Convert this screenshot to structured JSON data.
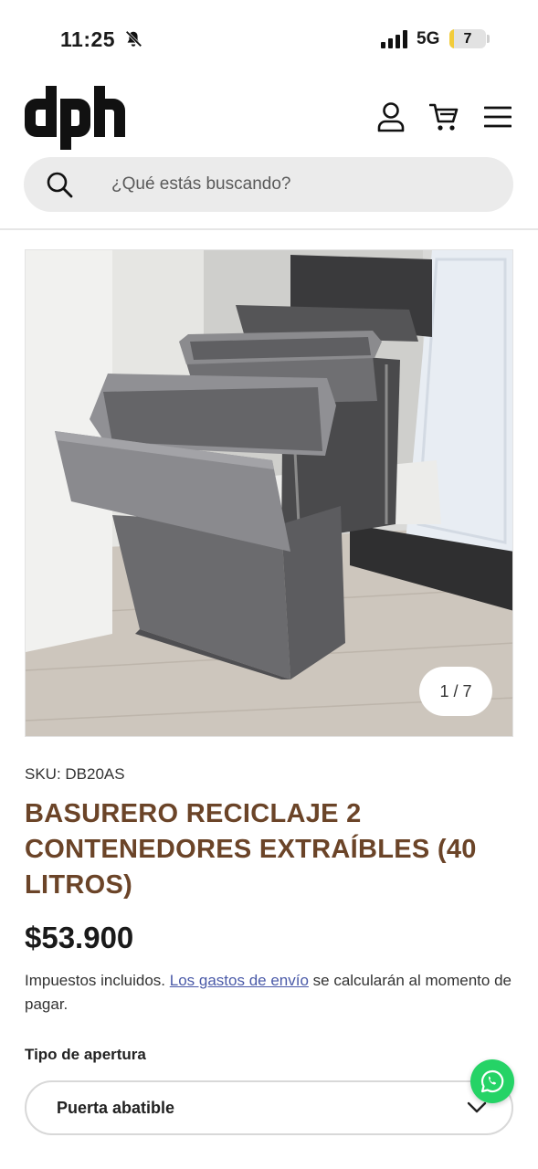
{
  "status_bar": {
    "time": "11:25",
    "network": "5G",
    "battery_level": "7",
    "battery_fraction": 0.07,
    "icons": [
      "bell-slash-icon",
      "signal-icon"
    ]
  },
  "header": {
    "logo_text": "dph",
    "icons": [
      "account-icon",
      "cart-icon",
      "menu-icon"
    ]
  },
  "search": {
    "placeholder": "¿Qué estás buscando?",
    "value": ""
  },
  "gallery": {
    "counter": "1 / 7"
  },
  "product": {
    "sku": "SKU: DB20AS",
    "title": "BASURERO RECICLAJE 2 CONTENEDORES EXTRAÍBLES (40 LITROS)",
    "price": "$53.900",
    "tax_prefix": "Impuestos incluidos. ",
    "shipping_link": "Los gastos de envío",
    "tax_suffix": " se calcularán al momento de pagar."
  },
  "option": {
    "label": "Tipo de apertura",
    "selected": "Puerta abatible"
  },
  "colors": {
    "title": "#6b4428",
    "link": "#4a5aa8",
    "whatsapp": "#25d366",
    "battery": "#f2cc3a"
  }
}
